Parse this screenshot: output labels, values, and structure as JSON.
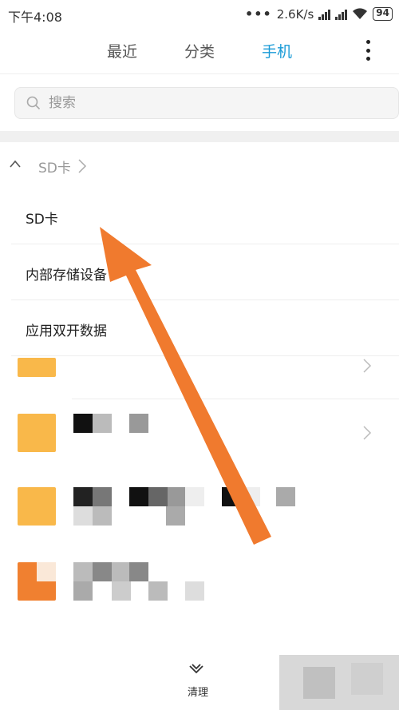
{
  "status_bar": {
    "time": "下午4:08",
    "dots": "•••",
    "network_speed": "2.6K/s",
    "battery": "94"
  },
  "tabs": [
    {
      "label": "最近",
      "active": false
    },
    {
      "label": "分类",
      "active": false
    },
    {
      "label": "手机",
      "active": true
    }
  ],
  "search": {
    "placeholder": "搜索"
  },
  "path": {
    "current": "SD卡"
  },
  "storage_menu": {
    "items": [
      {
        "label": "SD卡"
      },
      {
        "label": "内部存储设备"
      },
      {
        "label": "应用双开数据"
      }
    ]
  },
  "bottom": {
    "clean_label": "清理"
  },
  "colors": {
    "accent": "#1a9bd7",
    "folder": "#f9b84a",
    "arrow": "#f07a2e"
  }
}
